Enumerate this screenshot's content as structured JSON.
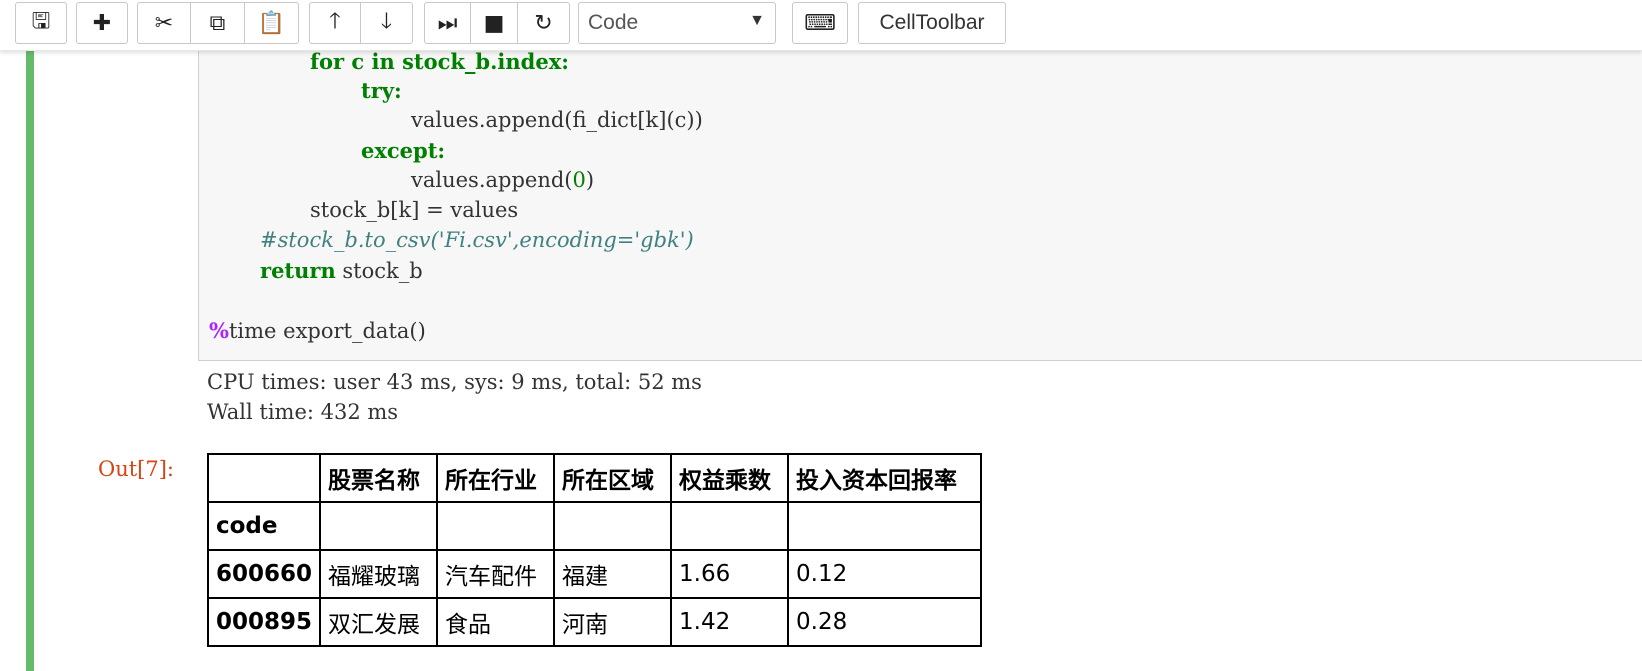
{
  "toolbar": {
    "buttons": [
      {
        "name": "save-icon",
        "glyph": "🖫"
      },
      {
        "name": "plus-icon",
        "glyph": "✚"
      },
      {
        "name": "scissors-icon",
        "glyph": "✂"
      },
      {
        "name": "copy-icon",
        "glyph": "⧉"
      },
      {
        "name": "paste-icon",
        "glyph": "📋"
      },
      {
        "name": "arrow-up-icon",
        "glyph": "🡑"
      },
      {
        "name": "arrow-down-icon",
        "glyph": "🡓"
      },
      {
        "name": "run-step-icon",
        "glyph": "⏭"
      },
      {
        "name": "stop-icon",
        "glyph": "■"
      },
      {
        "name": "refresh-icon",
        "glyph": "↻"
      }
    ],
    "cell_type_value": "Code",
    "keyboard_icon": "⌨",
    "celltoolbar_label": "CellToolbar"
  },
  "code": {
    "line_for": "for c in stock_b.index:",
    "line_try": "try:",
    "line_append": "values.append(fi_dict[k](c))",
    "line_except": "except:",
    "line_append0_pre": "values.append(",
    "line_append0_num": "0",
    "line_append0_post": ")",
    "line_assign": "stock_b[k] = values",
    "line_comment": "#stock_b.to_csv('Fi.csv',encoding='gbk')",
    "line_return_kw": "return",
    "line_return_rest": " stock_b",
    "line_magic_pct": "%",
    "line_magic_rest": "time export_data()"
  },
  "output": {
    "cpu_times": "CPU times: user 43 ms, sys: 9 ms, total: 52 ms",
    "wall_time": "Wall time: 432 ms",
    "prompt": "Out[7]:"
  },
  "table": {
    "columns": [
      "",
      "股票名称",
      "所在行业",
      "所在区域",
      "权益乘数",
      "投入资本回报率"
    ],
    "index_name": "code",
    "rows": [
      {
        "index": "600660",
        "cells": [
          "福耀玻璃",
          "汽车配件",
          "福建",
          "1.66",
          "0.12"
        ]
      },
      {
        "index": "000895",
        "cells": [
          "双汇发展",
          "食品",
          "河南",
          "1.42",
          "0.28"
        ]
      }
    ]
  }
}
